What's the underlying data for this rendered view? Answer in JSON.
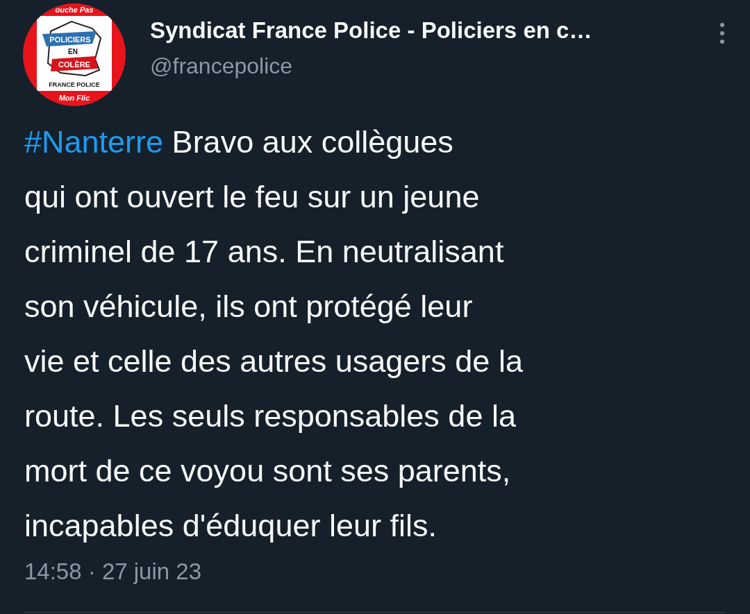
{
  "author": {
    "avatar": {
      "top_text": "ouche Pas",
      "banner_top": "POLICIERS",
      "middle": "EN",
      "banner_bottom": "COLÈRE",
      "caption": "FRANCE POLICE",
      "bottom_text": "Mon Flic"
    },
    "name": "Syndicat France Police - Policiers en c…",
    "handle": "@francepolice"
  },
  "tweet": {
    "hashtag": "#Nanterre",
    "body": " Bravo aux collègues\nqui ont ouvert le feu sur un jeune\ncriminel de 17 ans. En neutralisant\nson véhicule, ils ont protégé leur\nvie et celle des autres usagers de la\nroute. Les seuls responsables de la\nmort de ce voyou sont ses parents,\nincapables d'éduquer leur fils."
  },
  "time": "14:58 · 27 juin 23"
}
